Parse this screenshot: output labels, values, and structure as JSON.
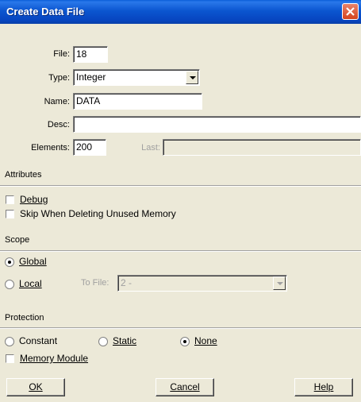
{
  "window": {
    "title": "Create Data File"
  },
  "form": {
    "file_label": "File:",
    "file_value": "18",
    "type_label": "Type:",
    "type_value": "Integer",
    "name_label": "Name:",
    "name_value": "DATA",
    "desc_label": "Desc:",
    "desc_value": "",
    "elements_label": "Elements:",
    "elements_value": "200",
    "last_label": "Last:",
    "last_value": ""
  },
  "attributes": {
    "heading": "Attributes",
    "debug_label": "Debug",
    "debug_checked": false,
    "skip_label": "Skip When Deleting Unused Memory",
    "skip_checked": false
  },
  "scope": {
    "heading": "Scope",
    "global_label": "Global",
    "local_label": "Local",
    "selected": "Global",
    "to_file_label": "To File:",
    "to_file_value": "2 -"
  },
  "protection": {
    "heading": "Protection",
    "constant_label": "Constant",
    "static_label": "Static",
    "none_label": "None",
    "selected": "None",
    "memory_module_label": "Memory Module",
    "memory_module_checked": false
  },
  "buttons": {
    "ok_label": "OK",
    "cancel_label": "Cancel",
    "help_label": "Help"
  }
}
